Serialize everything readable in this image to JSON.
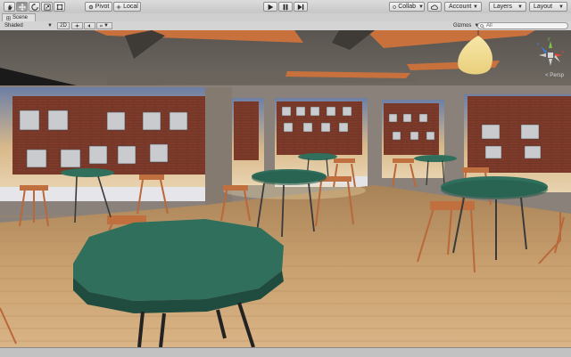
{
  "toolbar": {
    "tools": [
      {
        "name": "hand-tool",
        "active": false
      },
      {
        "name": "move-tool",
        "active": true
      },
      {
        "name": "rotate-tool",
        "active": false
      },
      {
        "name": "scale-tool",
        "active": false
      },
      {
        "name": "rect-tool",
        "active": false
      }
    ],
    "pivot_label": "Pivot",
    "local_label": "Local",
    "collab_label": "Collab",
    "account_label": "Account",
    "layers_label": "Layers",
    "layout_label": "Layout"
  },
  "scene_tab": {
    "label": "Scene"
  },
  "scene_toolbar": {
    "shading_mode": "Shaded",
    "mode_2d": "2D",
    "gizmos_label": "Gizmos",
    "search_placeholder": "All"
  },
  "viewport": {
    "projection_label": "< Persp"
  },
  "colors": {
    "accent_active": "#8f8f8f",
    "toolbar_bg": "#d0d0d0",
    "table_top": "#2f6f5c",
    "stool": "#b9683a",
    "floor": "#c79a68",
    "brick": "#7e3b2b"
  }
}
